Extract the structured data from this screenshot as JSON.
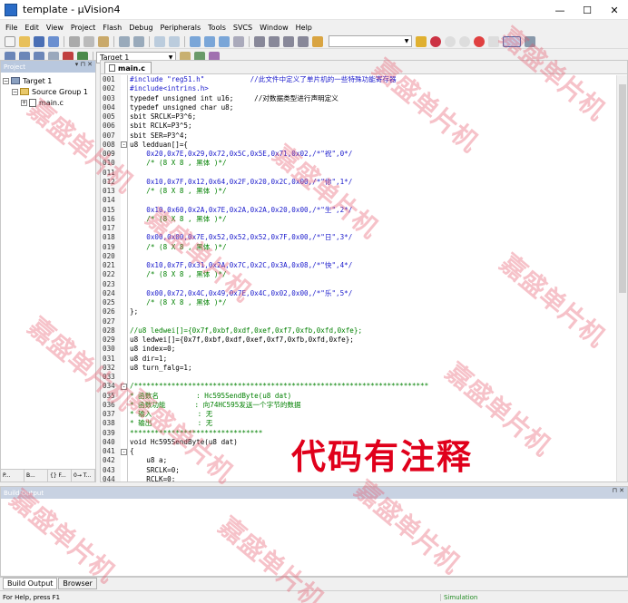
{
  "window": {
    "title": "template - µVision4",
    "controls": [
      "—",
      "☐",
      "✕"
    ]
  },
  "menu": [
    "File",
    "Edit",
    "View",
    "Project",
    "Flash",
    "Debug",
    "Peripherals",
    "Tools",
    "SVCS",
    "Window",
    "Help"
  ],
  "toolbar2": {
    "target": "Target 1"
  },
  "project_panel": {
    "title": "Project",
    "tree": {
      "target": "Target 1",
      "group": "Source Group 1",
      "file": "main.c"
    },
    "tabs": [
      "P...",
      "B...",
      "{} F...",
      "0→ T..."
    ]
  },
  "editor": {
    "tab": "main.c",
    "lines": [
      {
        "n": "001",
        "t": "#include \"reg51.h\"           //此文件中定义了单片机的一些特殊功能寄存器",
        "c": "c-blue"
      },
      {
        "n": "002",
        "t": "#include<intrins.h>",
        "c": "c-blue"
      },
      {
        "n": "003",
        "t": "typedef unsigned int u16;     //对数据类型进行声明定义",
        "c": "c-dark"
      },
      {
        "n": "004",
        "t": "typedef unsigned char u8;",
        "c": "c-dark"
      },
      {
        "n": "005",
        "t": "sbit SRCLK=P3^6;",
        "c": "c-dark"
      },
      {
        "n": "006",
        "t": "sbit RCLK=P3^5;",
        "c": "c-dark"
      },
      {
        "n": "007",
        "t": "sbit SER=P3^4;",
        "c": "c-dark"
      },
      {
        "n": "008",
        "t": "u8 ledduan[]={",
        "c": "c-dark",
        "fold": "-"
      },
      {
        "n": "009",
        "t": "    0x20,0x7E,0x29,0x72,0x5C,0x5E,0x71,0x02,/*\"祝\",0*/",
        "c": "c-blue"
      },
      {
        "n": "010",
        "t": "    /* (8 X 8 , 黑体 )*/",
        "c": "c-green"
      },
      {
        "n": "011",
        "t": "",
        "c": "c-dark"
      },
      {
        "n": "012",
        "t": "    0x10,0x7F,0x12,0x64,0x2F,0x20,0x2C,0x00,/*\"你\",1*/",
        "c": "c-blue"
      },
      {
        "n": "013",
        "t": "    /* (8 X 8 , 黑体 )*/",
        "c": "c-green"
      },
      {
        "n": "014",
        "t": "",
        "c": "c-dark"
      },
      {
        "n": "015",
        "t": "    0x10,0x60,0x2A,0x7E,0x2A,0x2A,0x20,0x00,/*\"生\",2*/",
        "c": "c-blue"
      },
      {
        "n": "016",
        "t": "    /* (8 X 8 , 黑体 )*/",
        "c": "c-green"
      },
      {
        "n": "017",
        "t": "",
        "c": "c-dark"
      },
      {
        "n": "018",
        "t": "    0x00,0x00,0x7E,0x52,0x52,0x52,0x7F,0x00,/*\"日\",3*/",
        "c": "c-blue"
      },
      {
        "n": "019",
        "t": "    /* (8 X 8 , 黑体 )*/",
        "c": "c-green"
      },
      {
        "n": "020",
        "t": "",
        "c": "c-dark"
      },
      {
        "n": "021",
        "t": "    0x10,0x7F,0x31,0x2A,0x7C,0x2C,0x3A,0x08,/*\"快\",4*/",
        "c": "c-blue"
      },
      {
        "n": "022",
        "t": "    /* (8 X 8 , 黑体 )*/",
        "c": "c-green"
      },
      {
        "n": "023",
        "t": "",
        "c": "c-dark"
      },
      {
        "n": "024",
        "t": "    0x00,0x72,0x4C,0x49,0x7E,0x4C,0x02,0x00,/*\"乐\",5*/",
        "c": "c-blue"
      },
      {
        "n": "025",
        "t": "    /* (8 X 8 , 黑体 )*/",
        "c": "c-green"
      },
      {
        "n": "026",
        "t": "};",
        "c": "c-dark"
      },
      {
        "n": "027",
        "t": "",
        "c": "c-dark"
      },
      {
        "n": "028",
        "t": "//u8 ledwei[]={0x7f,0xbf,0xdf,0xef,0xf7,0xfb,0xfd,0xfe};",
        "c": "c-green"
      },
      {
        "n": "029",
        "t": "u8 ledwei[]={0x7f,0xbf,0xdf,0xef,0xf7,0xfb,0xfd,0xfe};",
        "c": "c-dark"
      },
      {
        "n": "030",
        "t": "u8 index=0;",
        "c": "c-dark"
      },
      {
        "n": "031",
        "t": "u8 dir=1;",
        "c": "c-dark"
      },
      {
        "n": "032",
        "t": "u8 turn_falg=1;",
        "c": "c-dark"
      },
      {
        "n": "033",
        "t": "",
        "c": "c-dark"
      },
      {
        "n": "034",
        "t": "/***********************************************************************",
        "c": "c-green",
        "fold": "-"
      },
      {
        "n": "035",
        "t": "* 函数名         : Hc595SendByte(u8 dat)",
        "c": "c-green"
      },
      {
        "n": "036",
        "t": "* 函数功能       : 向74HC595发送一个字节的数据",
        "c": "c-green"
      },
      {
        "n": "037",
        "t": "* 输入           : 无",
        "c": "c-green"
      },
      {
        "n": "038",
        "t": "* 输出           : 无",
        "c": "c-green"
      },
      {
        "n": "039",
        "t": "***********************************************************************/",
        "c": "c-green"
      },
      {
        "n": "040",
        "t": "void Hc595SendByte(u8 dat)",
        "c": "c-dark"
      },
      {
        "n": "041",
        "t": "{",
        "c": "c-dark",
        "fold": "-"
      },
      {
        "n": "042",
        "t": "    u8 a;",
        "c": "c-dark"
      },
      {
        "n": "043",
        "t": "    SRCLK=0;",
        "c": "c-dark"
      },
      {
        "n": "044",
        "t": "    RCLK=0;",
        "c": "c-dark"
      }
    ]
  },
  "overlay": {
    "caption": "代码有注释"
  },
  "build_output": {
    "title": "Build Output",
    "tabs": [
      "Build Output",
      "Browser"
    ]
  },
  "status": {
    "help": "For Help, press F1",
    "mode": "Simulation"
  },
  "watermark": "嘉盛单片机"
}
